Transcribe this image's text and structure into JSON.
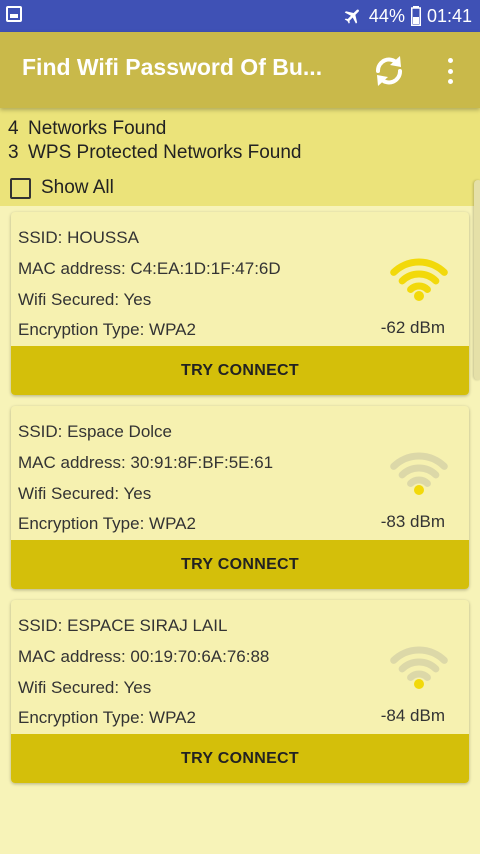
{
  "status_bar": {
    "battery": "44%",
    "time": "01:41",
    "icons": [
      "image-icon",
      "airplane-icon"
    ]
  },
  "app_bar": {
    "title": "Find Wifi Password Of Bu...",
    "icons": [
      "refresh-icon",
      "more-vert-icon"
    ],
    "color": "#c9b94a"
  },
  "summary": {
    "networks_count": "4",
    "networks_label": "Networks Found",
    "wps_count": "3",
    "wps_label": "WPS Protected Networks Found",
    "show_all_label": "Show All",
    "show_all_checked": false
  },
  "networks": [
    {
      "ssid": "SSID: HOUSSA",
      "mac": "MAC address: C4:EA:1D:1F:47:6D",
      "secured": "Wifi Secured: Yes",
      "encryption": "Encryption Type: WPA2",
      "signal": "-62 dBm",
      "signal_bars": 4,
      "button": "TRY CONNECT"
    },
    {
      "ssid": "SSID: Espace Dolce",
      "mac": "MAC address: 30:91:8F:BF:5E:61",
      "secured": "Wifi Secured: Yes",
      "encryption": "Encryption Type: WPA2",
      "signal": "-83 dBm",
      "signal_bars": 1,
      "button": "TRY CONNECT"
    },
    {
      "ssid": "SSID: ESPACE SIRAJ LAIL",
      "mac": "MAC address: 00:19:70:6A:76:88",
      "secured": "Wifi Secured: Yes",
      "encryption": "Encryption Type: WPA2",
      "signal": "-84 dBm",
      "signal_bars": 1,
      "button": "TRY CONNECT"
    }
  ],
  "colors": {
    "accent": "#d4bf0a",
    "signal_active": "#f2d90a",
    "signal_inactive": "#dcd8a8",
    "status_bar": "#3f51b5"
  }
}
